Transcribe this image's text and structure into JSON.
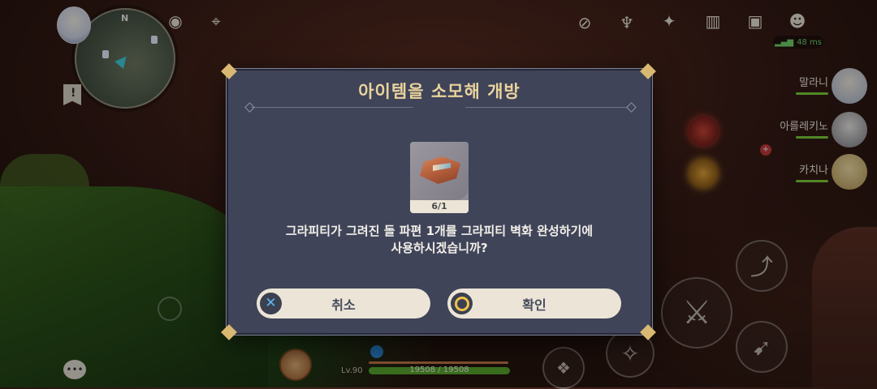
{
  "minimap": {
    "north_label": "N"
  },
  "hud": {
    "ping": "48 ms",
    "level": "Lv.90",
    "hp_text": "19508 / 19508",
    "hp_fraction": 1.0
  },
  "party": [
    {
      "name": "말라니"
    },
    {
      "name": "아를레키노"
    },
    {
      "name": "카치나"
    }
  ],
  "dialog": {
    "title": "아이템을 소모해 개방",
    "item_count": "6/1",
    "message_line1": "그라피티가 그려진 돌 파편 1개를 그라피티 벽화 완성하기에",
    "message_line2": "사용하시겠습니까?",
    "cancel_label": "취소",
    "confirm_label": "확인"
  },
  "colors": {
    "dialog_bg": "#3f4459",
    "title": "#ead39c",
    "button_bg": "#ece5d7",
    "cancel_icon": "#5bb8f0",
    "confirm_icon": "#f0c24a",
    "hp": "#5aa82d"
  }
}
